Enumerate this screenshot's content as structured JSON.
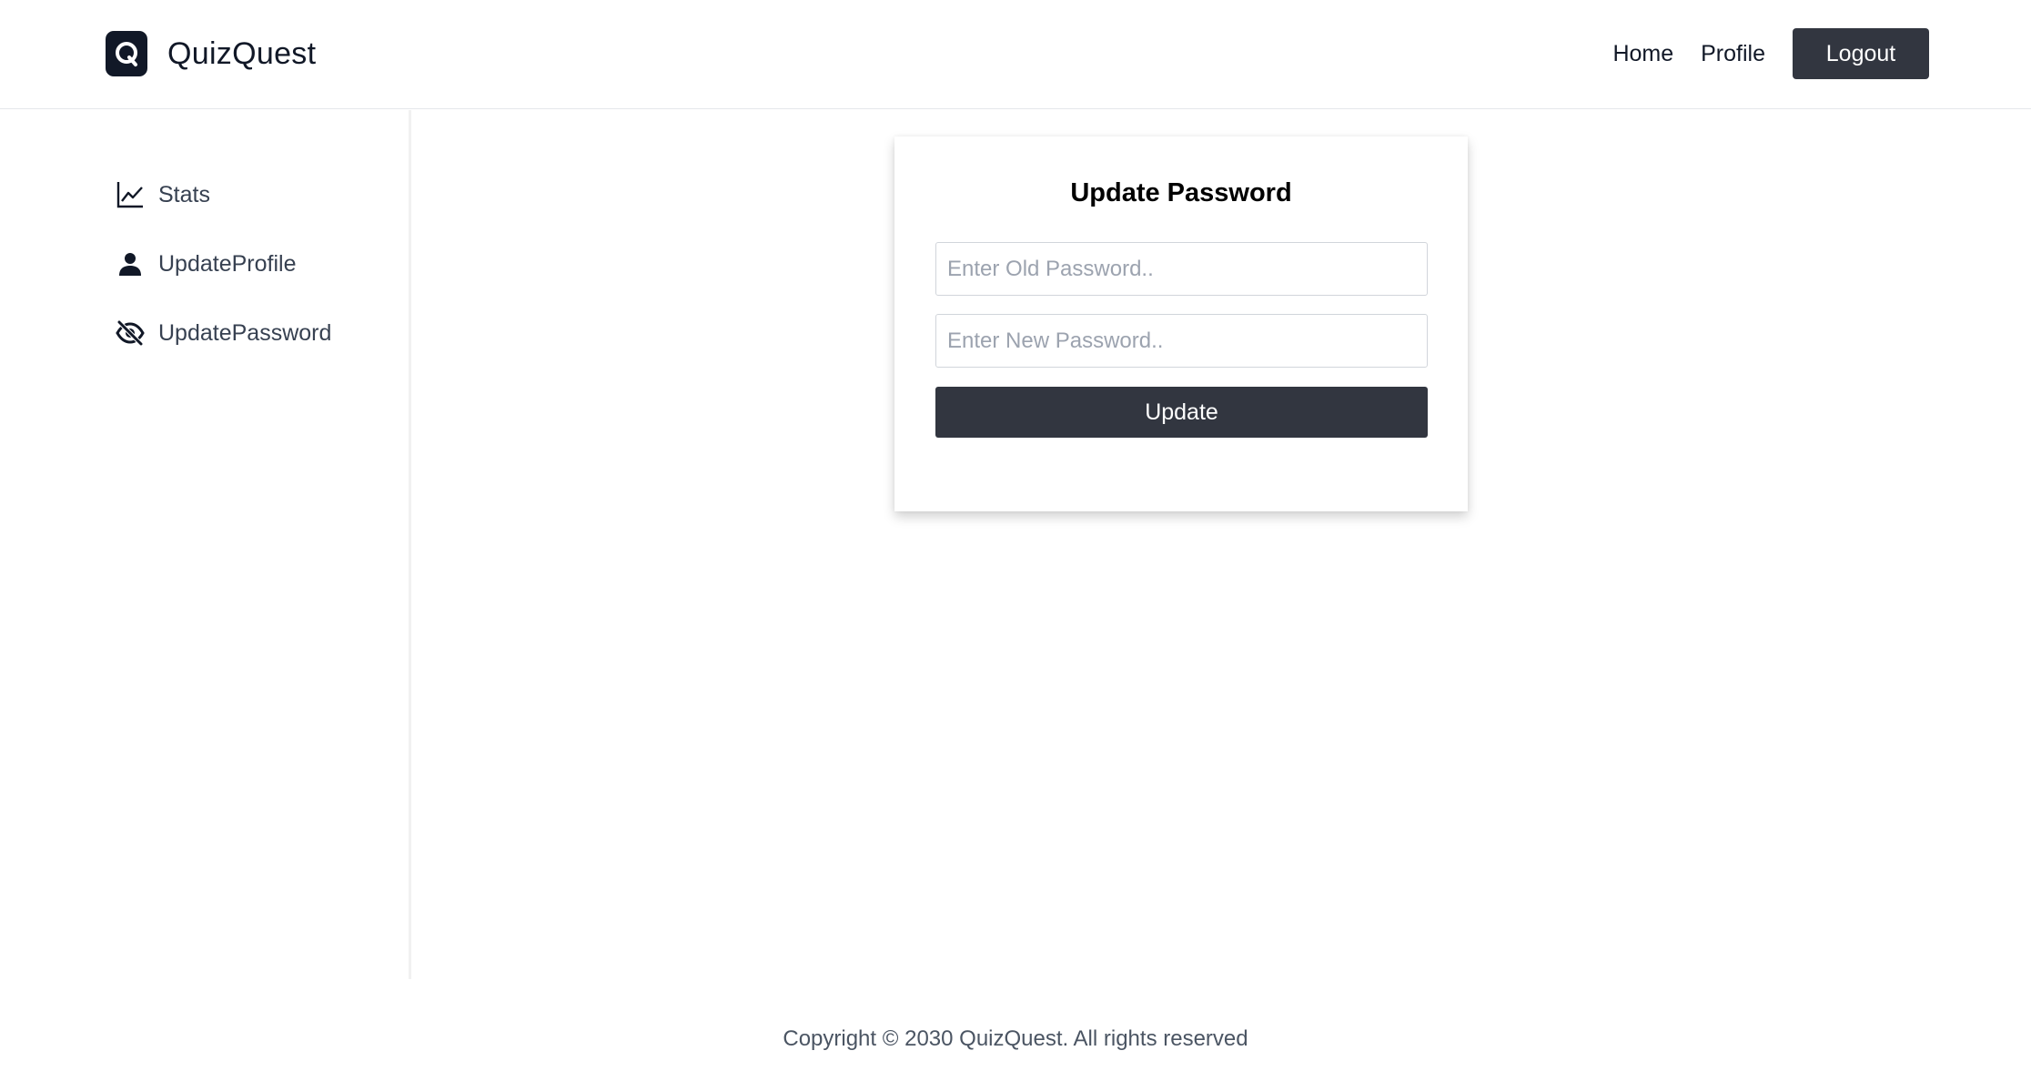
{
  "header": {
    "brand_name": "QuizQuest",
    "nav": {
      "home": "Home",
      "profile": "Profile",
      "logout": "Logout"
    }
  },
  "sidebar": {
    "items": [
      {
        "label": "Stats",
        "icon": "line-chart-icon"
      },
      {
        "label": "UpdateProfile",
        "icon": "user-icon"
      },
      {
        "label": "UpdatePassword",
        "icon": "eye-slash-icon"
      }
    ]
  },
  "form": {
    "title": "Update Password",
    "old_password": {
      "placeholder": "Enter Old Password..",
      "value": ""
    },
    "new_password": {
      "placeholder": "Enter New Password..",
      "value": ""
    },
    "submit_label": "Update"
  },
  "footer": {
    "text": "Copyright © 2030 QuizQuest. All rights reserved"
  },
  "colors": {
    "primary_dark": "#323640",
    "logo_bg": "#111827",
    "text": "#111827",
    "muted": "#4b5563"
  }
}
